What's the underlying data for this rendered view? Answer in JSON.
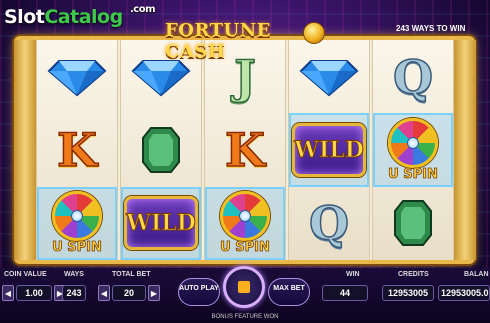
{
  "watermark": {
    "prefix": "Slot",
    "suffix": "Catalog",
    "domain": ".com"
  },
  "game": {
    "title": "FORTUNE CASH",
    "ways_banner": "243 WAYS TO WIN"
  },
  "reels": [
    [
      "diamond",
      "K",
      "U-SPIN"
    ],
    [
      "diamond",
      "emerald",
      "WILD"
    ],
    [
      "J",
      "K",
      "U-SPIN"
    ],
    [
      "diamond",
      "WILD",
      "Q"
    ],
    [
      "Q",
      "U-SPIN",
      "emerald"
    ]
  ],
  "uspin_label": "U SPIN",
  "wild_label": "WILD",
  "bottom_bar": {
    "coin_value_label": "COIN VALUE",
    "coin_value": "1.00",
    "ways_label": "WAYS",
    "ways": "243",
    "total_bet_label": "TOTAL BET",
    "total_bet": "20",
    "autoplay_label": "AUTO PLAY",
    "maxbet_label": "MAX BET",
    "win_label": "WIN",
    "win": "44",
    "credits_label": "CREDITS",
    "credits": "12953005",
    "balance_label": "BALAN",
    "balance": "12953005.0",
    "bonus_text": "BONUS FEATURE WON"
  },
  "colors": {
    "gold": "#e8b84a",
    "purple": "#3a1468",
    "spin_accent": "#ffb020"
  }
}
